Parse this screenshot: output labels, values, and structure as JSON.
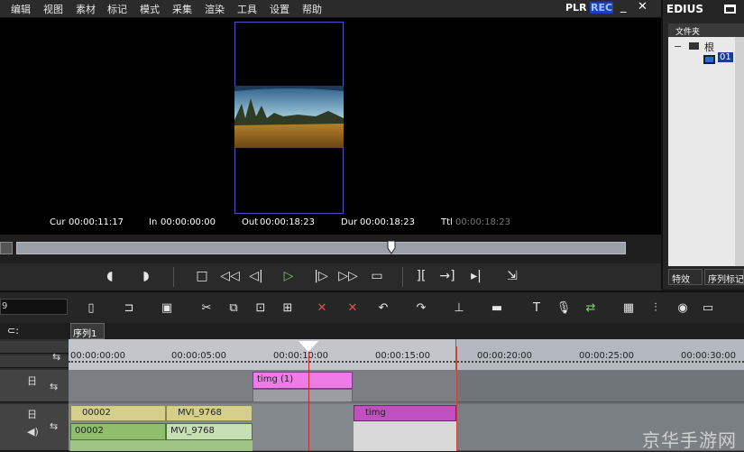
{
  "menu": {
    "items": [
      "编辑",
      "视图",
      "素材",
      "标记",
      "模式",
      "采集",
      "渲染",
      "工具",
      "设置",
      "帮助"
    ],
    "plr": "PLR",
    "rec": "REC"
  },
  "timecodes": {
    "cur_label": "Cur",
    "cur_value": "00:00:11:17",
    "in_label": "In",
    "in_value": "00:00:00:00",
    "out_label": "Out",
    "out_value": "00:00:18:23",
    "dur_label": "Dur",
    "dur_value": "00:00:18:23",
    "ttl_label": "Ttl",
    "ttl_value": "00:00:18:23"
  },
  "right_panel": {
    "app_name": "EDIUS",
    "header": "文件夹",
    "tree_root": "根",
    "tree_child": "01",
    "tabs": [
      "特效",
      "序列标记"
    ]
  },
  "timeline": {
    "field_value": "9",
    "sequence_tab": "序列1",
    "ruler_ticks": [
      "00:00:00:00",
      "00:00:05:00",
      "00:00:10:00",
      "00:00:15:00",
      "00:00:20:00",
      "00:00:25:00",
      "00:00:30:00"
    ],
    "clips": {
      "title_clip": "timg (1)",
      "v_clip_1": "00002",
      "v_clip_2": "MVI_9768",
      "v_clip_3": "timg",
      "a_clip_1": "00002",
      "a_clip_2": "MVI_9768"
    }
  },
  "watermark": "京华手游网",
  "colors": {
    "rec_bg": "#1d3fb8",
    "title_clip": "#f07be8",
    "video_clip": "#d6cf8c",
    "audio_clip": "#8fbf6d",
    "timg_clip": "#c050c0"
  },
  "icons": [
    "play-icon",
    "stop-icon",
    "rewind-icon",
    "fast-forward-icon",
    "scissors-icon",
    "folder-icon",
    "microphone-icon"
  ]
}
